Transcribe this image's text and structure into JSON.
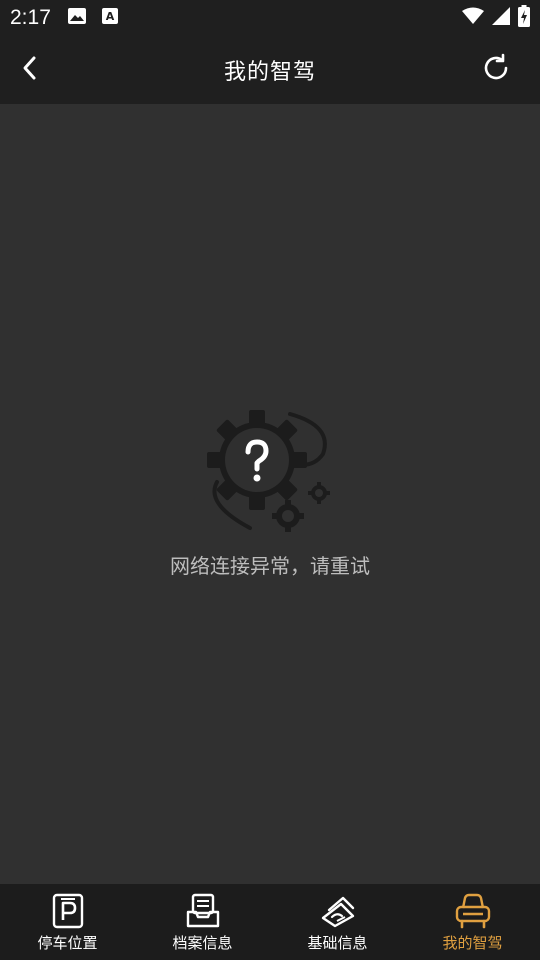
{
  "status_bar": {
    "time": "2:17",
    "icons_left": [
      "image-icon",
      "font-a-icon"
    ],
    "icons_right": [
      "wifi-icon",
      "signal-icon",
      "battery-charging-icon"
    ]
  },
  "app_bar": {
    "title": "我的智驾",
    "back_icon": "chevron-left-icon",
    "refresh_icon": "refresh-icon"
  },
  "content": {
    "error_icon": "gear-question-icon",
    "error_message": "网络连接异常，请重试"
  },
  "tabs": [
    {
      "label": "停车位置",
      "icon": "parking-icon",
      "active": false
    },
    {
      "label": "档案信息",
      "icon": "archive-icon",
      "active": false
    },
    {
      "label": "基础信息",
      "icon": "info-stack-icon",
      "active": false
    },
    {
      "label": "我的智驾",
      "icon": "car-icon",
      "active": true
    }
  ],
  "colors": {
    "background": "#303030",
    "bar_background": "#1f1f1f",
    "active_tab": "#e0a040",
    "message_text": "#bdbdbd"
  }
}
